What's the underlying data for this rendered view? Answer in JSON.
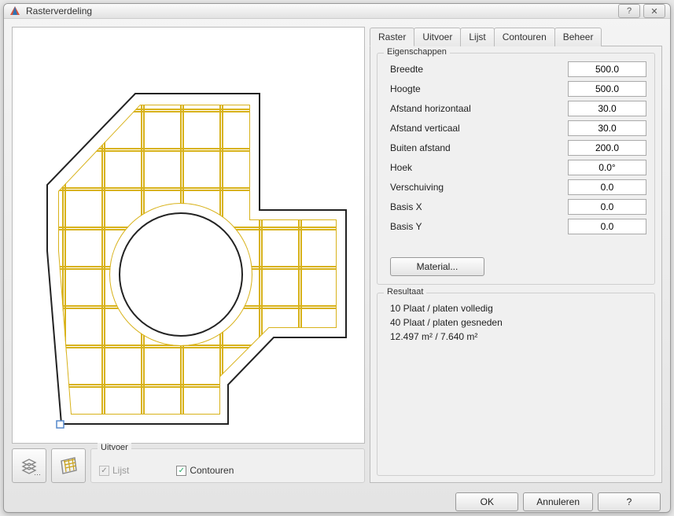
{
  "window": {
    "title": "Rasterverdeling"
  },
  "tabs": {
    "items": [
      {
        "label": "Raster"
      },
      {
        "label": "Uitvoer"
      },
      {
        "label": "Lijst"
      },
      {
        "label": "Contouren"
      },
      {
        "label": "Beheer"
      }
    ],
    "active": 0
  },
  "properties": {
    "group_label": "Eigenschappen",
    "rows": [
      {
        "label": "Breedte",
        "value": "500.0"
      },
      {
        "label": "Hoogte",
        "value": "500.0"
      },
      {
        "label": "Afstand horizontaal",
        "value": "30.0"
      },
      {
        "label": "Afstand verticaal",
        "value": "30.0"
      },
      {
        "label": "Buiten afstand",
        "value": "200.0"
      },
      {
        "label": "Hoek",
        "value": "0.0°"
      },
      {
        "label": "Verschuiving",
        "value": "0.0"
      },
      {
        "label": "Basis X",
        "value": "0.0"
      },
      {
        "label": "Basis Y",
        "value": "0.0"
      }
    ],
    "material_button": "Material..."
  },
  "result": {
    "group_label": "Resultaat",
    "lines": [
      "10 Plaat / platen volledig",
      "40 Plaat / platen gesneden",
      "12.497 m² / 7.640 m²"
    ]
  },
  "output": {
    "group_label": "Uitvoer",
    "lijst": {
      "label": "Lijst",
      "checked": true,
      "disabled": true
    },
    "contouren": {
      "label": "Contouren",
      "checked": true,
      "disabled": false
    }
  },
  "footer": {
    "ok": "OK",
    "cancel": "Annuleren",
    "help": "?"
  }
}
